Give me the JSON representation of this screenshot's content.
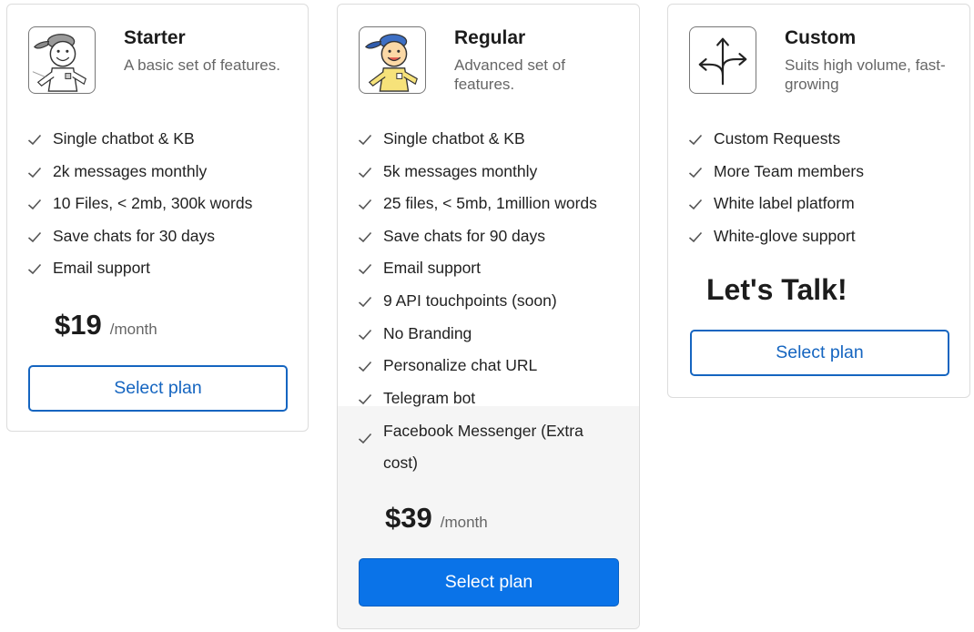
{
  "plans": [
    {
      "name": "Starter",
      "description": "A basic set of features.",
      "features": [
        "Single chatbot & KB",
        "2k messages monthly",
        "10 Files, < 2mb, 300k words",
        "Save chats for 30 days",
        "Email support"
      ],
      "price": "$19",
      "period": "/month",
      "button": "Select plan",
      "icon": "cartoon-boy-gray-cap-icon"
    },
    {
      "name": "Regular",
      "description": "Advanced set of features.",
      "features": [
        "Single chatbot & KB",
        "5k messages monthly",
        "25 files, < 5mb, 1million words",
        "Save chats for 90 days",
        "Email support",
        "9 API touchpoints (soon)",
        "No Branding",
        "Personalize chat URL",
        "Telegram bot",
        "Facebook Messenger (Extra cost)"
      ],
      "price": "$39",
      "period": "/month",
      "button": "Select plan",
      "icon": "cartoon-boy-blue-cap-icon"
    },
    {
      "name": "Custom",
      "description": "Suits high volume, fast-growing",
      "features": [
        "Custom Requests",
        "More Team members",
        "White label platform",
        "White-glove support"
      ],
      "cta": "Let's Talk!",
      "button": "Select plan",
      "icon": "branching-arrows-icon"
    }
  ],
  "colors": {
    "accent": "#1565c0",
    "primary_button": "#0a73e8",
    "check": "#555555",
    "card_border": "#dcdcdc",
    "highlight_bg": "#f5f5f5"
  }
}
